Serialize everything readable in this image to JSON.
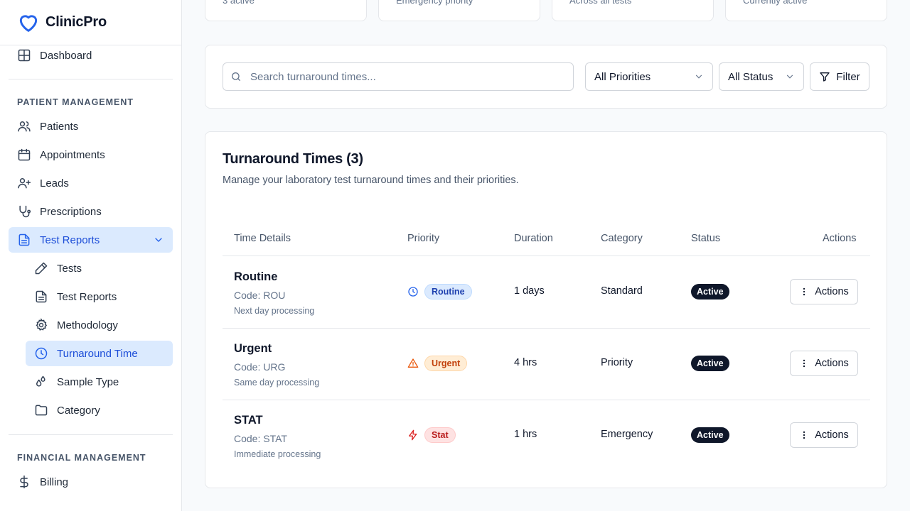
{
  "app": {
    "name": "ClinicPro"
  },
  "sidebar": {
    "partial_item": "Dashboard",
    "patient_section": "PATIENT MANAGEMENT",
    "items": [
      {
        "label": "Patients",
        "icon": "users-icon"
      },
      {
        "label": "Appointments",
        "icon": "calendar-icon"
      },
      {
        "label": "Leads",
        "icon": "user-plus-icon"
      },
      {
        "label": "Prescriptions",
        "icon": "stethoscope-icon"
      },
      {
        "label": "Test Reports",
        "icon": "file-text-icon",
        "expanded": true
      }
    ],
    "sub_items": [
      {
        "label": "Tests",
        "icon": "pencil-icon"
      },
      {
        "label": "Test Reports",
        "icon": "file-icon"
      },
      {
        "label": "Methodology",
        "icon": "gear-icon"
      },
      {
        "label": "Turnaround Time",
        "icon": "clock-icon",
        "active": true
      },
      {
        "label": "Sample Type",
        "icon": "droplets-icon"
      },
      {
        "label": "Category",
        "icon": "folder-icon"
      }
    ],
    "financial_section": "FINANCIAL MANAGEMENT",
    "billing": {
      "label": "Billing",
      "icon": "dollar-icon"
    }
  },
  "stats": [
    {
      "caption": "3 active"
    },
    {
      "caption": "Emergency priority"
    },
    {
      "caption": "Across all tests"
    },
    {
      "caption": "Currently active"
    }
  ],
  "filters": {
    "search_placeholder": "Search turnaround times...",
    "priority_select": "All Priorities",
    "status_select": "All Status",
    "filter_button": "Filter"
  },
  "table": {
    "title": "Turnaround Times (3)",
    "description": "Manage your laboratory test turnaround times and their priorities.",
    "headers": {
      "details": "Time Details",
      "priority": "Priority",
      "duration": "Duration",
      "category": "Category",
      "status": "Status",
      "actions": "Actions"
    },
    "rows": [
      {
        "name": "Routine",
        "code": "Code: ROU",
        "note": "Next day processing",
        "priority": "Routine",
        "priority_icon": "clock-icon",
        "duration": "1 days",
        "category": "Standard",
        "status": "Active",
        "action": "Actions"
      },
      {
        "name": "Urgent",
        "code": "Code: URG",
        "note": "Same day processing",
        "priority": "Urgent",
        "priority_icon": "warning-icon",
        "duration": "4 hrs",
        "category": "Priority",
        "status": "Active",
        "action": "Actions"
      },
      {
        "name": "STAT",
        "code": "Code: STAT",
        "note": "Immediate processing",
        "priority": "Stat",
        "priority_icon": "zap-icon",
        "duration": "1 hrs",
        "category": "Emergency",
        "status": "Active",
        "action": "Actions"
      }
    ]
  },
  "colors": {
    "accent": "#2563eb",
    "active_bg": "#dbeafe",
    "routine": "#2563eb",
    "urgent": "#ea580c",
    "stat": "#dc2626",
    "status_active": "#0f172a"
  }
}
